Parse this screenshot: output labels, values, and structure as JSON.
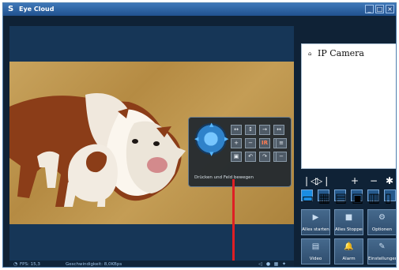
{
  "window": {
    "title": "Eye Cloud",
    "controls": [
      "_",
      "□",
      "×"
    ]
  },
  "icons": {
    "app": "S",
    "camera": "⌂"
  },
  "ptz": {
    "hint": "Drücken und Feld bewegen",
    "buttons": [
      "↔",
      "↕",
      "→",
      "↔",
      "+",
      "−",
      "IR",
      "⤢",
      "≡",
      "▣",
      "↶",
      "↷",
      "+",
      "−"
    ]
  },
  "status": {
    "fps_label": "FPS: 15,3",
    "speed_label": "Geschwindigkeit: 8,0KBps",
    "icons": [
      "◁",
      "●",
      "▦",
      "✦"
    ]
  },
  "camera_list": {
    "root": "IP Camera"
  },
  "controls": {
    "symbols": [
      "❘◁",
      "▷❘",
      "+",
      "−",
      "✱"
    ]
  },
  "views": [
    "▭",
    "▦",
    "▤",
    "▣",
    "▥",
    "▯"
  ],
  "actions": [
    {
      "label": "Alles starten",
      "icon": "▶"
    },
    {
      "label": "Alles Stoppen",
      "icon": "■"
    },
    {
      "label": "Optionen",
      "icon": "⚙"
    },
    {
      "label": "Video",
      "icon": "▤"
    },
    {
      "label": "Alarm",
      "icon": "🔔"
    },
    {
      "label": "Einstellungen",
      "icon": "✎"
    }
  ],
  "colors": {
    "frame": "#0f2236",
    "panel": "#163657",
    "accent": "#1a8de3",
    "marker": "#df1f24"
  }
}
